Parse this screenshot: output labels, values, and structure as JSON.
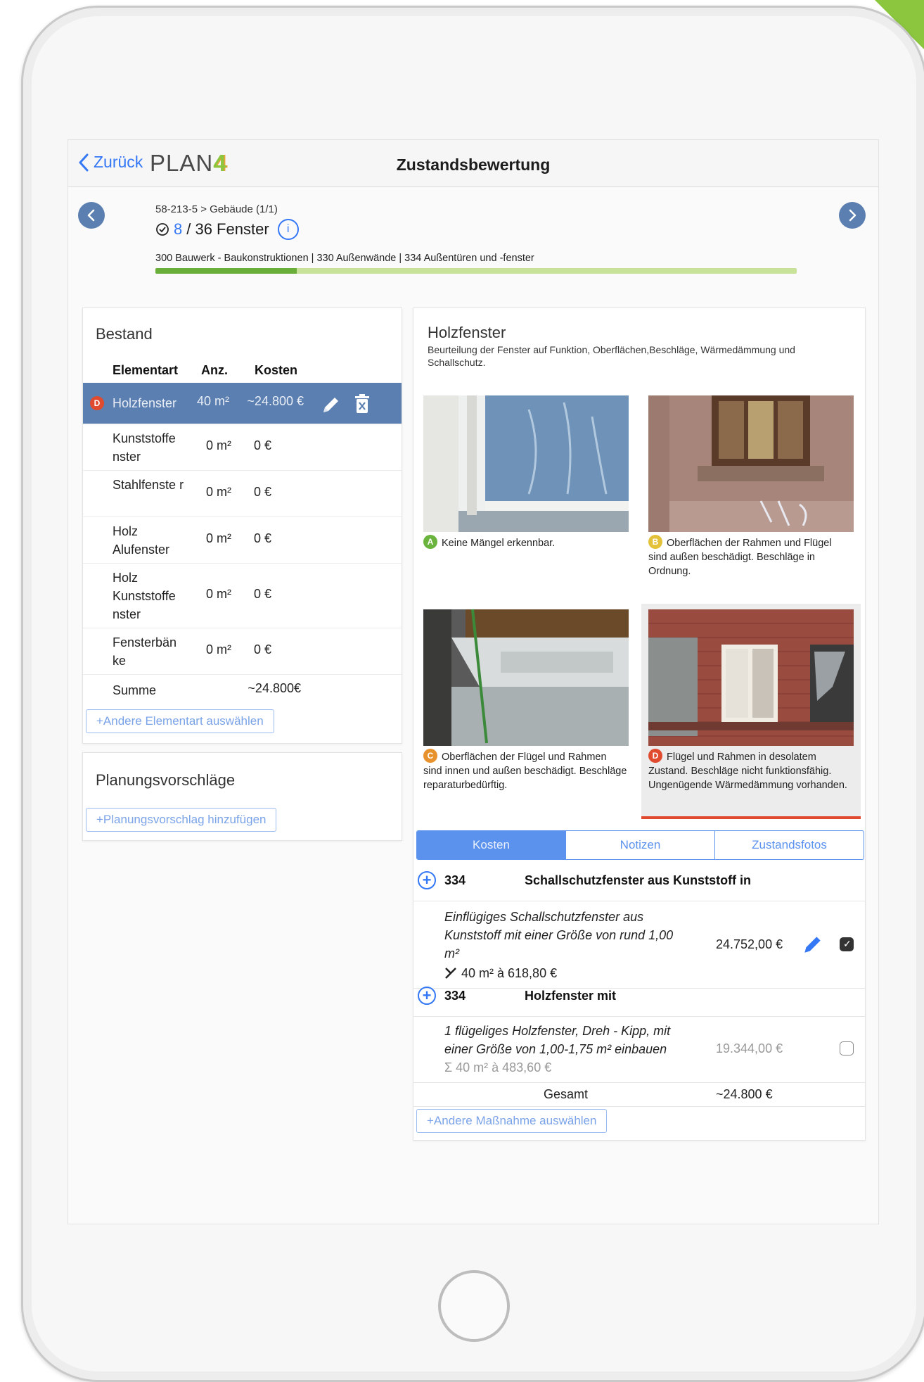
{
  "nav": {
    "back_label": "Zurück",
    "logo_text": "PLAN",
    "logo_digit": "4",
    "title": "Zustandsbewertung"
  },
  "header": {
    "breadcrumb": "58-213-5 > Gebäude (1/1)",
    "progress_done": "8",
    "progress_rest": "/ 36 Fenster",
    "progress_fraction": 0.22,
    "category_path": "300 Bauwerk - Baukonstruktionen | 330 Außenwände | 334 Außentüren und -fenster"
  },
  "bestand": {
    "title": "Bestand",
    "columns": [
      "Elementart",
      "Anz.",
      "Kosten"
    ],
    "rows": [
      {
        "badge": "D",
        "name": "Holzfenster",
        "qty": "40 m²",
        "cost": "~24.800 €"
      },
      {
        "name": "Kunststoffe nster",
        "qty": "0 m²",
        "cost": "0 €"
      },
      {
        "name": "Stahlfenste r",
        "qty": "0 m²",
        "cost": "0 €"
      },
      {
        "name": "Holz Alufenster",
        "qty": "0 m²",
        "cost": "0 €"
      },
      {
        "name": "Holz Kunststoffe nster",
        "qty": "0 m²",
        "cost": "0 €"
      },
      {
        "name": "Fensterbän ke",
        "qty": "0 m²",
        "cost": "0 €"
      }
    ],
    "sum_label": "Summe",
    "sum_value": "~24.800€",
    "add_button": "+Andere Elementart auswählen"
  },
  "planung": {
    "title": "Planungsvorschläge",
    "add_button": "+Planungsvorschlag hinzufügen"
  },
  "detail": {
    "title": "Holzfenster",
    "description": "Beurteilung der Fenster auf Funktion, Oberflächen,Beschläge, Wärmedämmung und Schallschutz.",
    "grades": [
      {
        "badge": "A",
        "color": "#6ab43e",
        "text": "Keine Mängel erkennbar."
      },
      {
        "badge": "B",
        "color": "#e3c23a",
        "text": "Oberflächen der Rahmen und Flügel sind außen beschädigt. Beschläge in Ordnung."
      },
      {
        "badge": "C",
        "color": "#e8922e",
        "text": "Oberflächen der Flügel und Rahmen sind innen und außen beschädigt. Beschläge reparaturbedürftig."
      },
      {
        "badge": "D",
        "color": "#e04a2f",
        "text": "Flügel und Rahmen in desolatem Zustand. Beschläge nicht funktionsfähig. Ungenügende Wärmedämmung vorhanden."
      }
    ],
    "selected_grade": "D",
    "tabs": [
      "Kosten",
      "Notizen",
      "Zustandsfotos"
    ],
    "active_tab": "Kosten",
    "measures": [
      {
        "code": "334",
        "title": "Schallschutzfenster aus Kunststoff in",
        "desc_line1": "Einflügiges Schallschutzfenster aus",
        "desc_line2": "Kunststoff mit einer Größe von rund 1,00",
        "desc_line3": "m²",
        "calc": "40 m² à 618,80 €",
        "amount": "24.752,00 €",
        "checked": true
      },
      {
        "code": "334",
        "title": "Holzfenster mit",
        "desc_line1": "1 flügeliges Holzfenster, Dreh - Kipp, mit",
        "desc_line2": "einer Größe von 1,00-1,75 m² einbauen",
        "calc": "Σ 40 m² à 483,60 €",
        "amount": "19.344,00 €",
        "checked": false
      }
    ],
    "total_label": "Gesamt",
    "total_value": "~24.800 €",
    "add_button": "+Andere Maßnahme auswählen"
  },
  "colors": {
    "accent": "#5b7fb0",
    "link": "#3478f6",
    "progress_fill": "#6aae3a",
    "progress_track": "#c8e29a"
  }
}
